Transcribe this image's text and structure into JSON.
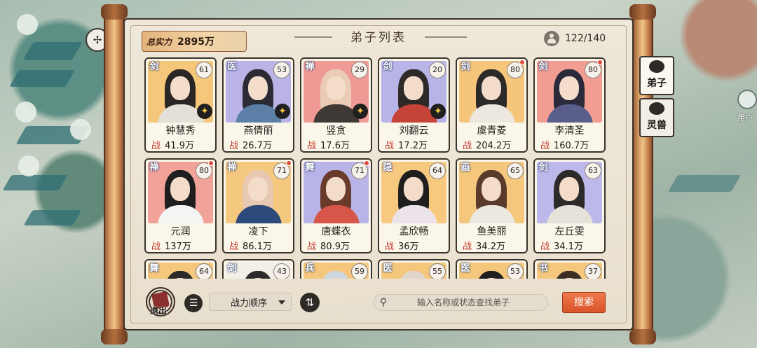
{
  "header": {
    "power_label": "总实力",
    "power_value": "2895万",
    "title": "弟子列表",
    "count": "122/140"
  },
  "cards": [
    {
      "cls": "剑",
      "level": "61",
      "name": "钟慧秀",
      "stat_label": "战",
      "stat": "41.9万",
      "bg": "#f5c77a",
      "hair": "#2b2626",
      "robe": "#e4e0d8",
      "star": true,
      "dot": false
    },
    {
      "cls": "医",
      "level": "53",
      "name": "燕倩丽",
      "stat_label": "战",
      "stat": "26.7万",
      "bg": "#b9b3e6",
      "hair": "#2a2b33",
      "robe": "#5c7fa8",
      "star": true,
      "dot": false
    },
    {
      "cls": "禅",
      "level": "29",
      "name": "竖贪",
      "stat_label": "战",
      "stat": "17.6万",
      "bg": "#f09a96",
      "hair": "#e9cbb6",
      "robe": "#3e3934",
      "star": true,
      "dot": false
    },
    {
      "cls": "剑",
      "level": "20",
      "name": "刘翻云",
      "stat_label": "战",
      "stat": "17.2万",
      "bg": "#b8b4e8",
      "hair": "#2d2a28",
      "robe": "#c64437",
      "star": true,
      "dot": false
    },
    {
      "cls": "剑",
      "level": "80",
      "name": "虞青菱",
      "stat_label": "战",
      "stat": "204.2万",
      "bg": "#f4c57b",
      "hair": "#2c2a29",
      "robe": "#ece7df",
      "star": false,
      "dot": true
    },
    {
      "cls": "剑",
      "level": "80",
      "name": "李清圣",
      "stat_label": "战",
      "stat": "160.7万",
      "bg": "#f19d92",
      "hair": "#2a2a3a",
      "robe": "#5a5e8a",
      "star": false,
      "dot": true
    },
    {
      "cls": "禅",
      "level": "80",
      "name": "元润",
      "stat_label": "战",
      "stat": "137万",
      "bg": "#f1a39a",
      "hair": "#1e1e1e",
      "robe": "#f4f4f2",
      "star": false,
      "dot": true
    },
    {
      "cls": "禅",
      "level": "71",
      "name": "凌下",
      "stat_label": "战",
      "stat": "86.1万",
      "bg": "#f4c87e",
      "hair": "#e8c8b0",
      "robe": "#2c4a7a",
      "star": false,
      "dot": true
    },
    {
      "cls": "舞",
      "level": "71",
      "name": "唐蝶衣",
      "stat_label": "战",
      "stat": "80.9万",
      "bg": "#b9b4e8",
      "hair": "#6a3a2a",
      "robe": "#d8554a",
      "star": false,
      "dot": true
    },
    {
      "cls": "隐",
      "level": "64",
      "name": "孟欣畅",
      "stat_label": "战",
      "stat": "36万",
      "bg": "#f6c97f",
      "hair": "#1f1f1f",
      "robe": "#ece4ea",
      "star": false,
      "dot": false
    },
    {
      "cls": "画",
      "level": "65",
      "name": "鱼美丽",
      "stat_label": "战",
      "stat": "34.2万",
      "bg": "#f4c77c",
      "hair": "#5a3a2a",
      "robe": "#ede8df",
      "star": false,
      "dot": false
    },
    {
      "cls": "剑",
      "level": "63",
      "name": "左丘雯",
      "stat_label": "战",
      "stat": "34.1万",
      "bg": "#bdb8ea",
      "hair": "#2d2b2a",
      "robe": "#e6e2da",
      "star": false,
      "dot": false
    },
    {
      "cls": "舞",
      "level": "64",
      "name": "",
      "stat_label": "",
      "stat": "",
      "bg": "#f4c77c",
      "hair": "#2d2b2a",
      "robe": "#e6e2da",
      "star": false,
      "dot": false
    },
    {
      "cls": "剑",
      "level": "43",
      "name": "",
      "stat_label": "",
      "stat": "",
      "bg": "#f2efe6",
      "hair": "#2d2b2a",
      "robe": "#e6e2da",
      "star": false,
      "dot": false
    },
    {
      "cls": "兵",
      "level": "59",
      "name": "",
      "stat_label": "",
      "stat": "",
      "bg": "#f4c77c",
      "hair": "#cfd8e0",
      "robe": "#e6e2da",
      "star": false,
      "dot": false
    },
    {
      "cls": "医",
      "level": "55",
      "name": "",
      "stat_label": "",
      "stat": "",
      "bg": "#f4c77c",
      "hair": "#e0d6cc",
      "robe": "#e6e2da",
      "star": false,
      "dot": false
    },
    {
      "cls": "医",
      "level": "53",
      "name": "",
      "stat_label": "",
      "stat": "",
      "bg": "#f4c77c",
      "hair": "#1f1f1f",
      "robe": "#e6e2da",
      "star": false,
      "dot": false
    },
    {
      "cls": "书",
      "level": "37",
      "name": "",
      "stat_label": "",
      "stat": "",
      "bg": "#f4c77c",
      "hair": "#3a2e24",
      "robe": "#e6e2da",
      "star": false,
      "dot": false
    }
  ],
  "bottom": {
    "exit_label": "退出",
    "sort_label": "战力顺序",
    "search_placeholder": "输入名称或状态查找弟子",
    "search_button": "搜索"
  },
  "side_tabs": [
    {
      "label": "弟子"
    },
    {
      "label": "灵兽"
    }
  ],
  "misc": {
    "user_label": "用户"
  }
}
